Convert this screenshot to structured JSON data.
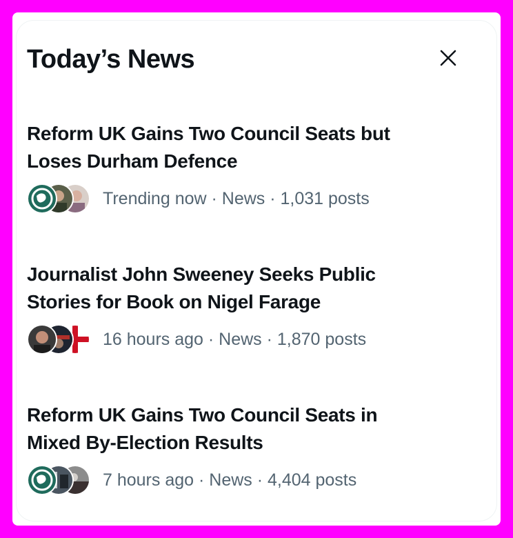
{
  "panel": {
    "title": "Today’s News",
    "close_icon": "close-icon"
  },
  "news": [
    {
      "headline_line1": "Reform UK Gains Two Council Seats but",
      "headline_line2": "Loses Durham Defence",
      "meta": "Trending now · News · 1,031 posts"
    },
    {
      "headline_line1": "Journalist John Sweeney Seeks Public",
      "headline_line2": "Stories for Book on Nigel Farage",
      "meta": "16 hours ago · News · 1,870 posts"
    },
    {
      "headline_line1": "Reform UK Gains Two Council Seats in",
      "headline_line2": "Mixed By-Election Results",
      "meta": "7 hours ago · News · 4,404 posts"
    }
  ],
  "colors": {
    "background": "#ff00ff",
    "text_primary": "#0f1419",
    "text_secondary": "#536471"
  }
}
